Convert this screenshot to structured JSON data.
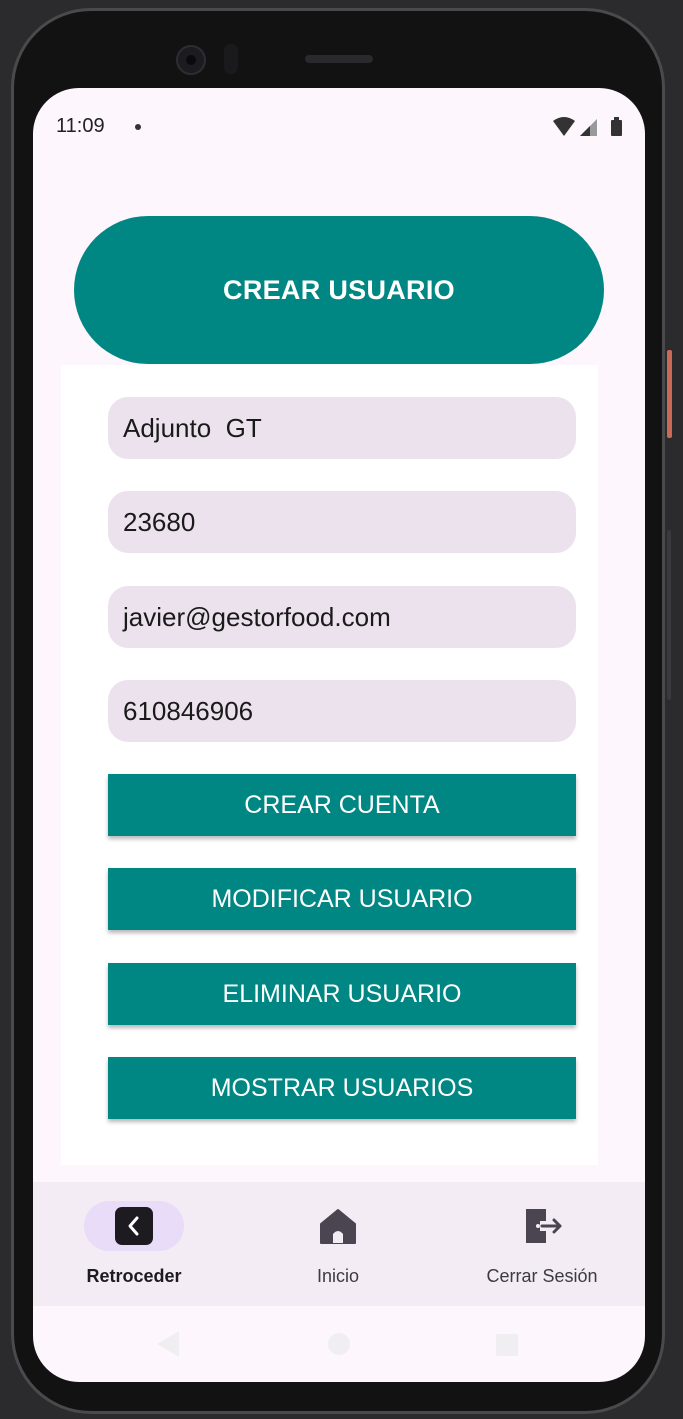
{
  "status_bar": {
    "time": "11:09"
  },
  "header": {
    "title": "CREAR USUARIO"
  },
  "form": {
    "fields": [
      {
        "value": "Adjunto  GT"
      },
      {
        "value": "23680"
      },
      {
        "value": "javier@gestorfood.com"
      },
      {
        "value": "610846906"
      }
    ],
    "buttons": [
      {
        "label": "CREAR CUENTA"
      },
      {
        "label": "MODIFICAR USUARIO"
      },
      {
        "label": "ELIMINAR USUARIO"
      },
      {
        "label": "MOSTRAR USUARIOS"
      }
    ]
  },
  "bottom_nav": {
    "items": [
      {
        "label": "Retroceder",
        "icon": "back-icon",
        "active": true
      },
      {
        "label": "Inicio",
        "icon": "home-icon",
        "active": false
      },
      {
        "label": "Cerrar Sesión",
        "icon": "logout-icon",
        "active": false
      }
    ]
  },
  "colors": {
    "primary": "#018783",
    "field_background": "#ece2ee",
    "screen_background": "#fdf6fd",
    "nav_background": "#f3ecf5",
    "active_indicator": "#e8dcf8"
  }
}
